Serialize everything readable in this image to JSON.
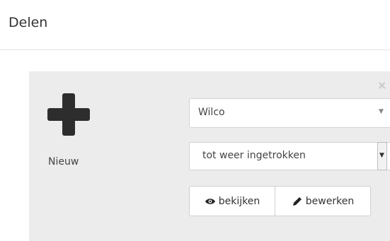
{
  "dialog": {
    "title": "Delen"
  },
  "panel": {
    "close_icon": "×",
    "new_label": "Nieuw",
    "user_select": {
      "value": "Wilco",
      "caret": "▼"
    },
    "duration_select": {
      "value": "tot weer ingetrokken",
      "caret": "▼"
    },
    "buttons": {
      "view_label": "bekijken",
      "edit_label": "bewerken"
    }
  }
}
